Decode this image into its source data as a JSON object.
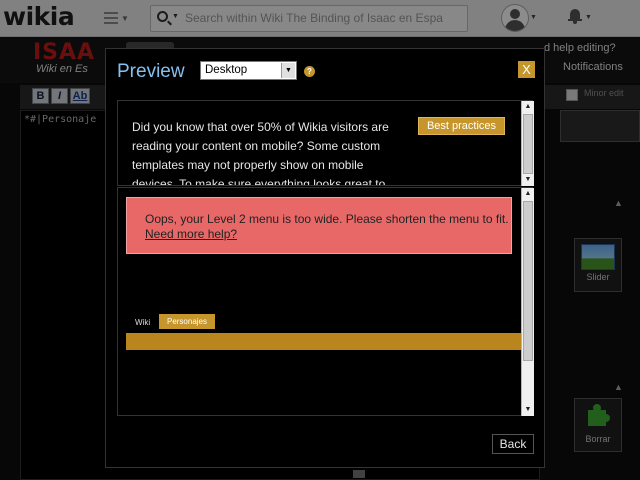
{
  "global_nav": {
    "logo": "wikia",
    "search_placeholder": "Search within Wiki The Binding of Isaac en Espa"
  },
  "wiki_header": {
    "wordmark": "ISAA",
    "wordmark_sub": "Wiki en Es",
    "need_help": "d help editing?",
    "notifications": "Notifications"
  },
  "toolbar": {
    "bold": "B",
    "italic": "I",
    "link": "Ab",
    "minor_edit": "Minor edit"
  },
  "editor": {
    "content": "*#|Personaje"
  },
  "right_rail": {
    "slider_label": "Slider",
    "borrar_label": "Borrar"
  },
  "modal": {
    "title": "Preview",
    "device_selected": "Desktop",
    "help": "?",
    "close": "X",
    "notice_text": "Did you know that over 50% of Wikia visitors are reading your content on mobile? Some custom templates may not properly show on mobile devices. To make sure everything looks great to",
    "best_practices": "Best practices",
    "error_message": "Oops, your Level 2 menu is too wide. Please shorten the menu to fit.",
    "error_link": "Need more help?",
    "nav_wiki": "Wiki",
    "nav_tab": "Personajes",
    "back": "Back"
  },
  "colors": {
    "accent_gold": "#c6952b",
    "error_red": "#e86868",
    "title_blue": "#87c0ee"
  }
}
